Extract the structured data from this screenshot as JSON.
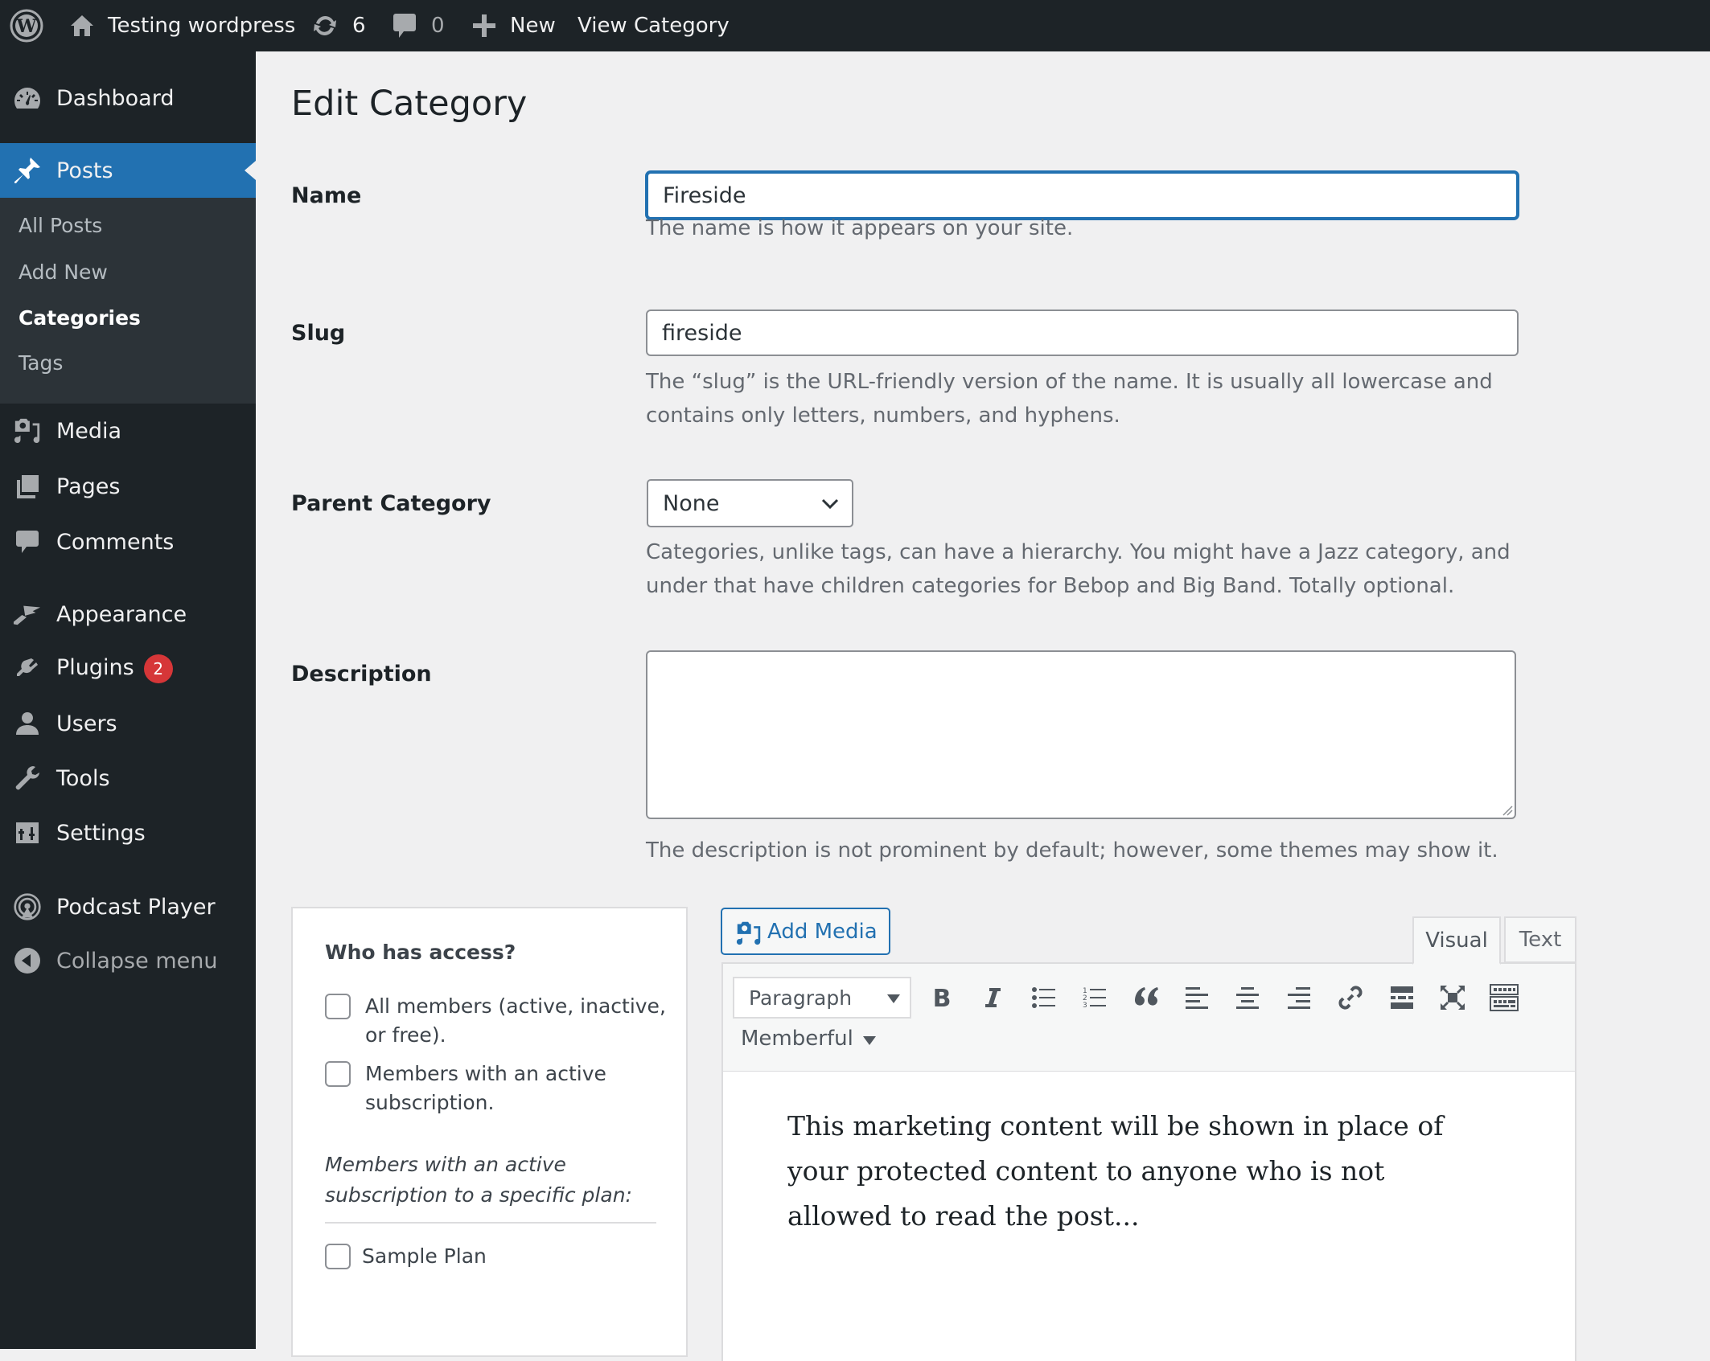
{
  "adminbar": {
    "site_name": "Testing wordpress",
    "updates_count": "6",
    "comments_count": "0",
    "new_label": "New",
    "view_label": "View Category"
  },
  "sidebar": {
    "items": [
      {
        "label": "Dashboard",
        "icon": "dashboard-icon"
      },
      {
        "label": "Posts",
        "icon": "pin-icon",
        "current": true
      },
      {
        "label": "Media",
        "icon": "media-icon"
      },
      {
        "label": "Pages",
        "icon": "pages-icon"
      },
      {
        "label": "Comments",
        "icon": "comment-icon"
      },
      {
        "label": "Appearance",
        "icon": "brush-icon"
      },
      {
        "label": "Plugins",
        "icon": "plugin-icon",
        "badge": "2"
      },
      {
        "label": "Users",
        "icon": "user-icon"
      },
      {
        "label": "Tools",
        "icon": "wrench-icon"
      },
      {
        "label": "Settings",
        "icon": "settings-icon"
      },
      {
        "label": "Podcast Player",
        "icon": "podcast-icon"
      },
      {
        "label": "Collapse menu",
        "icon": "collapse-icon"
      }
    ],
    "posts_submenu": [
      {
        "label": "All Posts"
      },
      {
        "label": "Add New"
      },
      {
        "label": "Categories",
        "current": true
      },
      {
        "label": "Tags"
      }
    ]
  },
  "page": {
    "title": "Edit Category",
    "name": {
      "label": "Name",
      "value": "Fireside",
      "help": "The name is how it appears on your site."
    },
    "slug": {
      "label": "Slug",
      "value": "fireside",
      "help": "The “slug” is the URL-friendly version of the name. It is usually all lowercase and contains only letters, numbers, and hyphens."
    },
    "parent": {
      "label": "Parent Category",
      "selected": "None",
      "help": "Categories, unlike tags, can have a hierarchy. You might have a Jazz category, and under that have children categories for Bebop and Big Band. Totally optional."
    },
    "description": {
      "label": "Description",
      "value": "",
      "help": "The description is not prominent by default; however, some themes may show it."
    }
  },
  "access": {
    "title": "Who has access?",
    "options": [
      {
        "label": "All members (active, inactive, or free).",
        "checked": false
      },
      {
        "label": "Members with an active subscription.",
        "checked": false
      }
    ],
    "plan_note": "Members with an active subscription to a specific plan:",
    "plans": [
      {
        "label": "Sample Plan",
        "checked": false
      }
    ]
  },
  "editor": {
    "add_media_label": "Add Media",
    "tabs": [
      {
        "label": "Visual",
        "active": true
      },
      {
        "label": "Text",
        "active": false
      }
    ],
    "format_select": "Paragraph",
    "toolbar_buttons": [
      "bold",
      "italic",
      "bulleted-list",
      "numbered-list",
      "blockquote",
      "align-left",
      "align-center",
      "align-right",
      "insert-link",
      "read-more",
      "fullscreen",
      "toolbar-toggle"
    ],
    "memberful_menu": "Memberful",
    "content": "This marketing content will be shown in place of your protected content to anyone who is not allowed to read the post..."
  },
  "colors": {
    "admin_dark": "#1d2327",
    "accent_blue": "#2271b1",
    "submenu_bg": "#2c3338",
    "badge_red": "#d63638",
    "page_bg": "#f0f0f1"
  }
}
